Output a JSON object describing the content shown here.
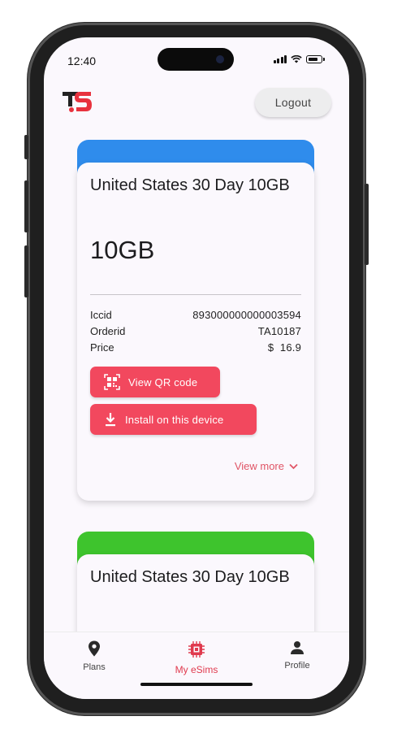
{
  "status_bar": {
    "time": "12:40"
  },
  "header": {
    "logout_label": "Logout"
  },
  "cards": [
    {
      "top_color": "#2f8cec",
      "title": "United States 30 Day 10GB",
      "data_amount": "10GB",
      "details": [
        {
          "label": "Iccid",
          "value": "893000000000003594"
        },
        {
          "label": "Orderid",
          "value": "TA10187"
        },
        {
          "label": "Price",
          "value": "$  16.9"
        }
      ],
      "qr_button": "View QR code",
      "install_button": "Install on this device",
      "view_more": "View more"
    },
    {
      "top_color": "#3ec42d",
      "title": "United States 30 Day 10GB"
    }
  ],
  "bottom_nav": {
    "items": [
      {
        "label": "Plans",
        "icon": "location-pin-icon"
      },
      {
        "label": "My eSims",
        "icon": "chip-icon",
        "active": true
      },
      {
        "label": "Profile",
        "icon": "person-icon"
      }
    ]
  },
  "colors": {
    "accent": "#f2485e",
    "active_nav": "#e03a4e"
  }
}
